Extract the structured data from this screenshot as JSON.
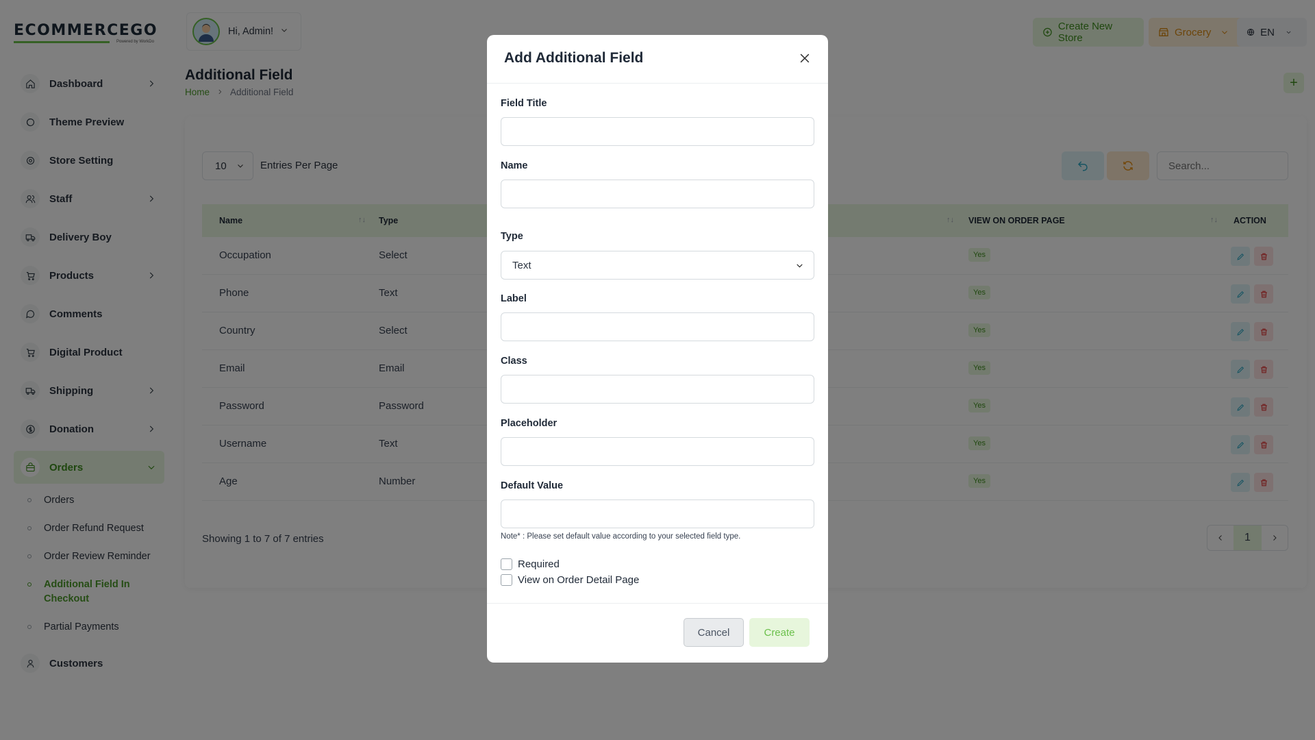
{
  "brand": {
    "name": "ECOMMERCEGO",
    "sub": "Powered by WorkDo"
  },
  "header": {
    "greeting": "Hi, Admin!",
    "create_store": "Create New Store",
    "store": "Grocery",
    "lang": "EN"
  },
  "sidebar": {
    "items": [
      {
        "label": "Dashboard",
        "icon": "home-icon",
        "chevron": true
      },
      {
        "label": "Theme Preview",
        "icon": "theme-icon",
        "chevron": false
      },
      {
        "label": "Store Setting",
        "icon": "settings-icon",
        "chevron": false
      },
      {
        "label": "Staff",
        "icon": "users-icon",
        "chevron": true
      },
      {
        "label": "Delivery Boy",
        "icon": "truck-icon",
        "chevron": false
      },
      {
        "label": "Products",
        "icon": "cart-icon",
        "chevron": true
      },
      {
        "label": "Comments",
        "icon": "comment-icon",
        "chevron": false
      },
      {
        "label": "Digital Product",
        "icon": "cart-icon",
        "chevron": false
      },
      {
        "label": "Shipping",
        "icon": "shipping-icon",
        "chevron": true
      },
      {
        "label": "Donation",
        "icon": "coin-icon",
        "chevron": true
      },
      {
        "label": "Orders",
        "icon": "bag-icon",
        "chevron": true
      }
    ],
    "orders_sub": [
      "Orders",
      "Order Refund Request",
      "Order Review Reminder",
      "Additional Field In Checkout",
      "Partial Payments"
    ],
    "customers": "Customers"
  },
  "page": {
    "title": "Additional Field",
    "breadcrumb_home": "Home",
    "breadcrumb_current": "Additional Field",
    "entries_value": "10",
    "entries_label": "Entries Per Page",
    "search_placeholder": "Search...",
    "showing": "Showing 1 to 7 of 7 entries",
    "current_page": "1"
  },
  "table": {
    "headers": {
      "name": "Name",
      "type": "Type",
      "view": "VIEW ON ORDER PAGE",
      "action": "ACTION"
    },
    "rows": [
      {
        "name": "Occupation",
        "type": "Select",
        "view": "Yes"
      },
      {
        "name": "Phone",
        "type": "Text",
        "view": "Yes"
      },
      {
        "name": "Country",
        "type": "Select",
        "view": "Yes"
      },
      {
        "name": "Email",
        "type": "Email",
        "view": "Yes"
      },
      {
        "name": "Password",
        "type": "Password",
        "view": "Yes"
      },
      {
        "name": "Username",
        "type": "Text",
        "view": "Yes"
      },
      {
        "name": "Age",
        "type": "Number",
        "view": "Yes"
      }
    ]
  },
  "modal": {
    "title": "Add Additional Field",
    "field_title": "Field Title",
    "name": "Name",
    "type": "Type",
    "type_value": "Text",
    "label": "Label",
    "class": "Class",
    "placeholder": "Placeholder",
    "default_value": "Default Value",
    "note": "Note* : Please set default value according to your selected field type.",
    "required": "Required",
    "view_on_order": "View on Order Detail Page",
    "cancel": "Cancel",
    "create": "Create"
  },
  "colors": {
    "accent": "#6bc04b",
    "accent_dark": "#3f8f1f",
    "accent_bg": "#e9f6e1",
    "danger": "#e23a3a",
    "info": "#2fa9c4",
    "warning": "#e69118"
  }
}
